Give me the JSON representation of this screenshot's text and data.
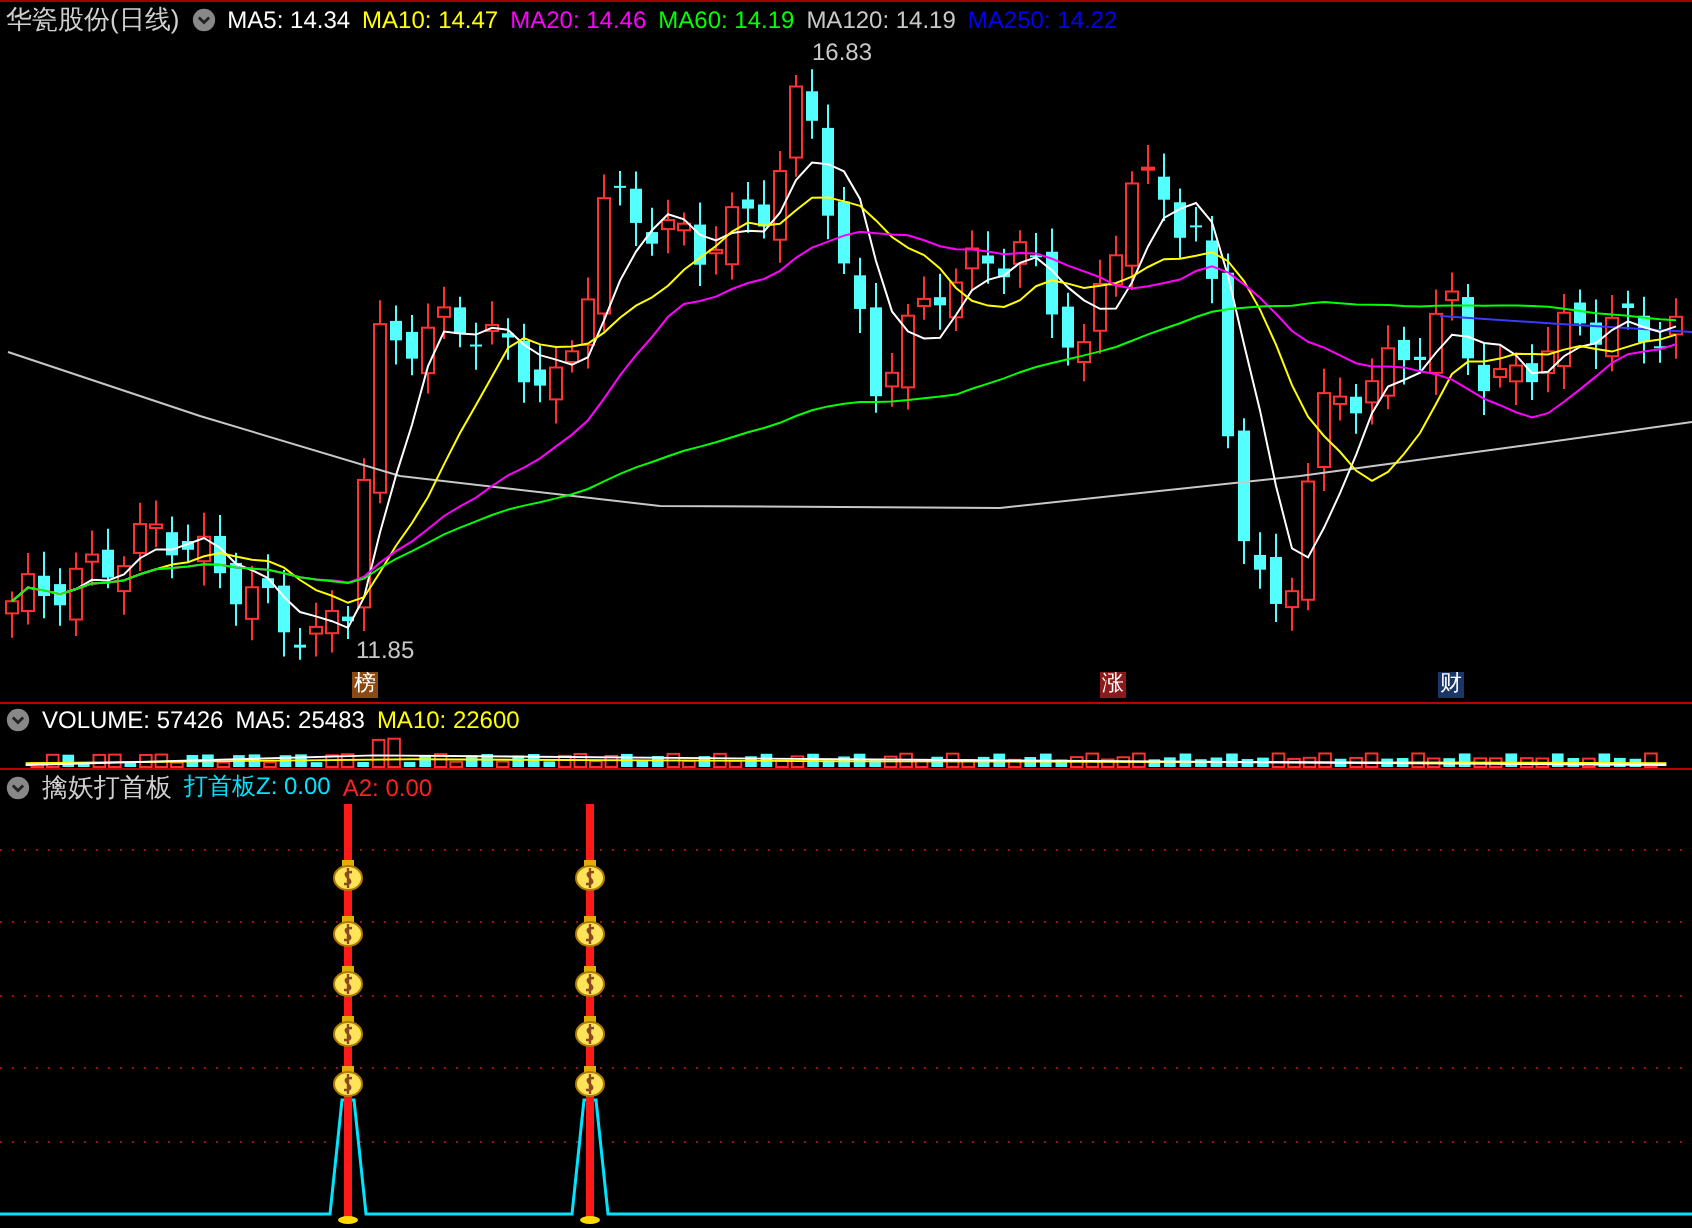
{
  "main_panel": {
    "title": "华瓷股份(日线)",
    "indicators": [
      {
        "label": "MA5: 14.34",
        "color": "#ffffff"
      },
      {
        "label": "MA10: 14.47",
        "color": "#ffff00"
      },
      {
        "label": "MA20: 14.46",
        "color": "#ff00ff"
      },
      {
        "label": "MA60: 14.19",
        "color": "#00ff00"
      },
      {
        "label": "MA120: 14.19",
        "color": "#c8c8c8"
      },
      {
        "label": "MA250: 14.22",
        "color": "#0000ff"
      }
    ],
    "high_label": "16.83",
    "low_label": "11.85",
    "event_tags": [
      {
        "label": "榜",
        "color": "#8b4a14"
      },
      {
        "label": "涨",
        "color": "#8b1a1a"
      },
      {
        "label": "财",
        "color": "#1a3668"
      }
    ]
  },
  "volume_panel": {
    "indicators": [
      {
        "label": "VOLUME: 57426",
        "color": "#ffffff"
      },
      {
        "label": "MA5: 25483",
        "color": "#ffffff"
      },
      {
        "label": "MA10: 22600",
        "color": "#ffff00"
      }
    ]
  },
  "signal_panel": {
    "title": "擒妖打首板",
    "indicators": [
      {
        "label": "打首板Z: 0.00",
        "color": "#00e5ff"
      },
      {
        "label": "A2: 0.00",
        "color": "#ff2020"
      }
    ]
  }
}
